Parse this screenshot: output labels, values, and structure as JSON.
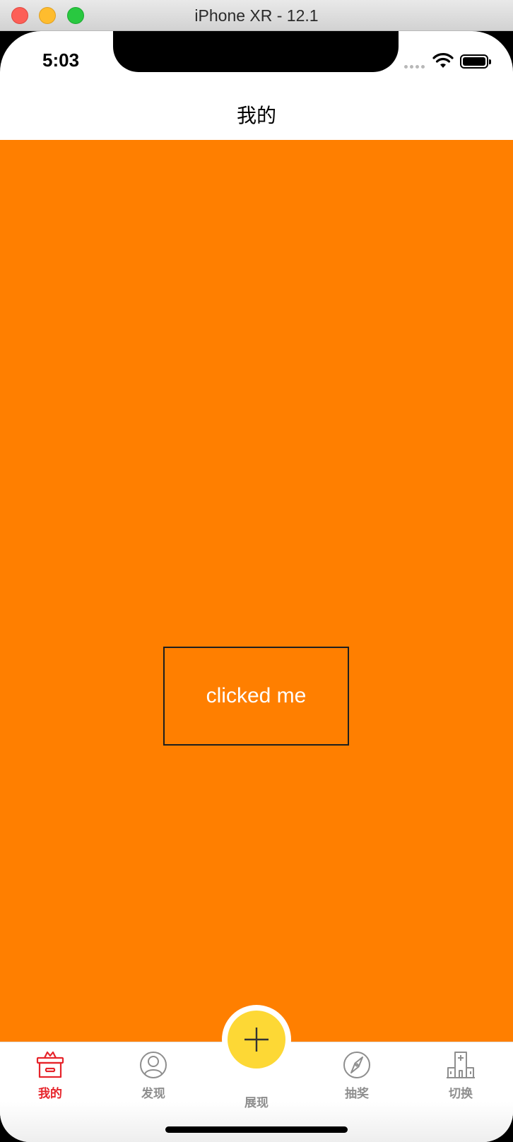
{
  "window": {
    "title": "iPhone XR - 12.1"
  },
  "status_bar": {
    "time": "5:03"
  },
  "nav": {
    "title": "我的"
  },
  "content": {
    "background_color": "#ff7f00",
    "button_label": "clicked me"
  },
  "tabbar": {
    "active_color": "#e6242b",
    "inactive_color": "#8e8e8e",
    "center_button_color": "#fdd835",
    "tabs": [
      {
        "label": "我的",
        "icon": "gift-box-icon",
        "active": true
      },
      {
        "label": "发现",
        "icon": "user-circle-icon",
        "active": false
      },
      {
        "label": "展现",
        "icon": "plus-icon",
        "active": false
      },
      {
        "label": "抽奖",
        "icon": "compass-icon",
        "active": false
      },
      {
        "label": "切换",
        "icon": "building-icon",
        "active": false
      }
    ]
  }
}
